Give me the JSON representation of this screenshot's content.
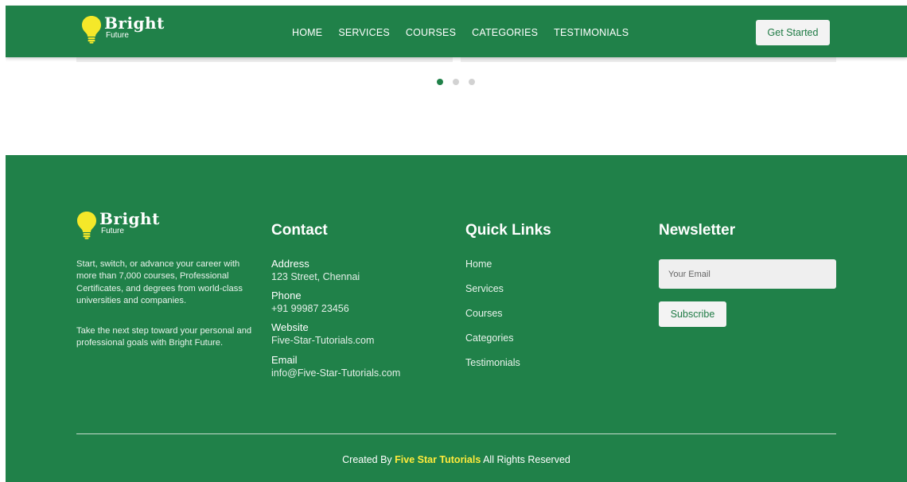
{
  "brand": {
    "name": "Bright",
    "tagline": "Future",
    "bulb_color": "#f5e829"
  },
  "header": {
    "nav": [
      "HOME",
      "SERVICES",
      "COURSES",
      "CATEGORIES",
      "TESTIMONIALS"
    ],
    "cta_label": "Get Started"
  },
  "carousel": {
    "dots": 3,
    "active_index": 0
  },
  "footer": {
    "about": [
      "Start, switch, or advance your career with more than 7,000 courses, Professional Certificates, and degrees from world-class universities and companies.",
      "Take the next step toward your personal and professional goals with Bright Future."
    ],
    "contact": {
      "title": "Contact",
      "items": [
        {
          "label": "Address",
          "value": "123 Street, Chennai"
        },
        {
          "label": "Phone",
          "value": "+91 99987 23456"
        },
        {
          "label": "Website",
          "value": "Five-Star-Tutorials.com"
        },
        {
          "label": "Email",
          "value": "info@Five-Star-Tutorials.com"
        }
      ]
    },
    "quick_links": {
      "title": "Quick Links",
      "items": [
        "Home",
        "Services",
        "Courses",
        "Categories",
        "Testimonials"
      ]
    },
    "newsletter": {
      "title": "Newsletter",
      "placeholder": "Your Email",
      "button_label": "Subscribe"
    },
    "copyright": {
      "prefix": "Created By",
      "highlight": "Five Star Tutorials",
      "suffix": "All Rights Reserved"
    }
  },
  "colors": {
    "primary_green": "#208149",
    "highlight_yellow": "#ffeb3b"
  }
}
